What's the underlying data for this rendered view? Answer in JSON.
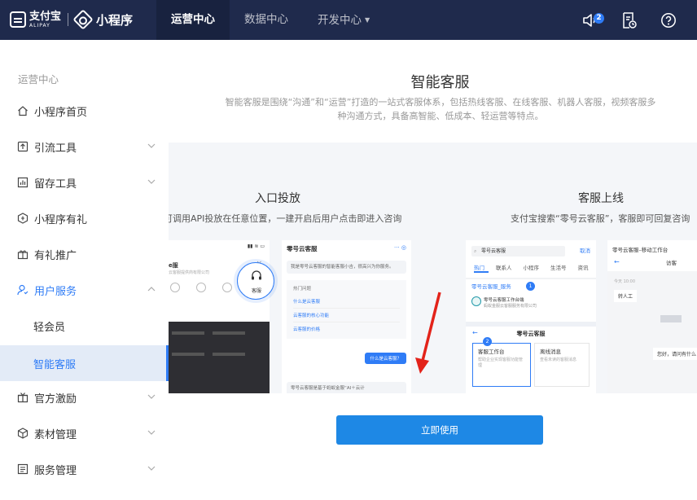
{
  "header": {
    "brand_cn": "支付宝",
    "brand_en": "ALIPAY",
    "product": "小程序",
    "nav": [
      {
        "label": "运营中心"
      },
      {
        "label": "数据中心"
      },
      {
        "label": "开发中心"
      }
    ],
    "notification_count": "2",
    "icons": [
      "speaker-icon",
      "document-history-icon",
      "help-icon"
    ]
  },
  "sidebar": {
    "heading": "运营中心",
    "items": [
      {
        "label": "小程序首页",
        "icon": "home-icon"
      },
      {
        "label": "引流工具",
        "icon": "export-icon"
      },
      {
        "label": "留存工具",
        "icon": "bar-chart-icon"
      },
      {
        "label": "小程序有礼",
        "icon": "gift-hex-icon"
      },
      {
        "label": "有礼推广",
        "icon": "gift-box-icon"
      },
      {
        "label": "用户服务",
        "icon": "user-service-icon"
      },
      {
        "label": "轻会员",
        "icon": ""
      },
      {
        "label": "智能客服",
        "icon": ""
      },
      {
        "label": "官方激励",
        "icon": "gift-icon"
      },
      {
        "label": "素材管理",
        "icon": "cube-icon"
      },
      {
        "label": "服务管理",
        "icon": "list-icon"
      }
    ]
  },
  "main": {
    "title": "智能客服",
    "description": "智能客服是围绕“沟通”和“运营”打造的一站式客服体系，包括热线客服、在线客服、机器人客服，视频客服多种沟通方式，具备高智能、低成本、轻运营等特点。",
    "features": [
      {
        "title": "入口投放",
        "desc": "可调用API投放在任意位置，一建开启后用户点击即进入咨询"
      },
      {
        "title": "客服上线",
        "desc": "支付宝搜索“零号云客服”，客服即可回复咨询"
      }
    ],
    "mock": {
      "phone1_title": "e服",
      "phone1_sub": "云客服提供商有限公司",
      "service_label": "客服",
      "chat_title": "零号云客服",
      "chat_greeting": "我是零号云客服的智能客服小吉，很高兴为你服务。",
      "chat_section": "热门问题",
      "chat_links": [
        "什么是云客服",
        "云客服的核心功能",
        "云客服的价格"
      ],
      "chat_question": "什么是云客服？",
      "chat_answer": "零号云客服是基于蚂蚁金服“AI＋云计",
      "search_text": "零号云客服",
      "search_btn": "取消",
      "search_tabs": [
        "热门",
        "联系人",
        "小程序",
        "生活号",
        "资讯"
      ],
      "result_title": "零号云客服_服务",
      "result_name": "零号云客服工作台端",
      "result_org": "蚂蚁金服云客服服务有限公司",
      "panel_title": "零号云客服",
      "panel_card1": "客服工作台",
      "panel_card1_desc": "帮助企业实现客服功能管理",
      "panel_card2": "离线消息",
      "panel_card2_desc": "查看未读的客服消息",
      "mobile_title": "零号云客服–移动工作台",
      "mobile_visitor": "访客",
      "mobile_time": "今天 10:00",
      "mobile_transfer": "转人工",
      "mobile_reply": "您好，请问有什么"
    },
    "cta": "立即使用"
  },
  "colors": {
    "topbar": "#1f2a4c",
    "accent": "#2f7cf6",
    "button": "#1e88e5",
    "arrow": "#e3231a"
  }
}
